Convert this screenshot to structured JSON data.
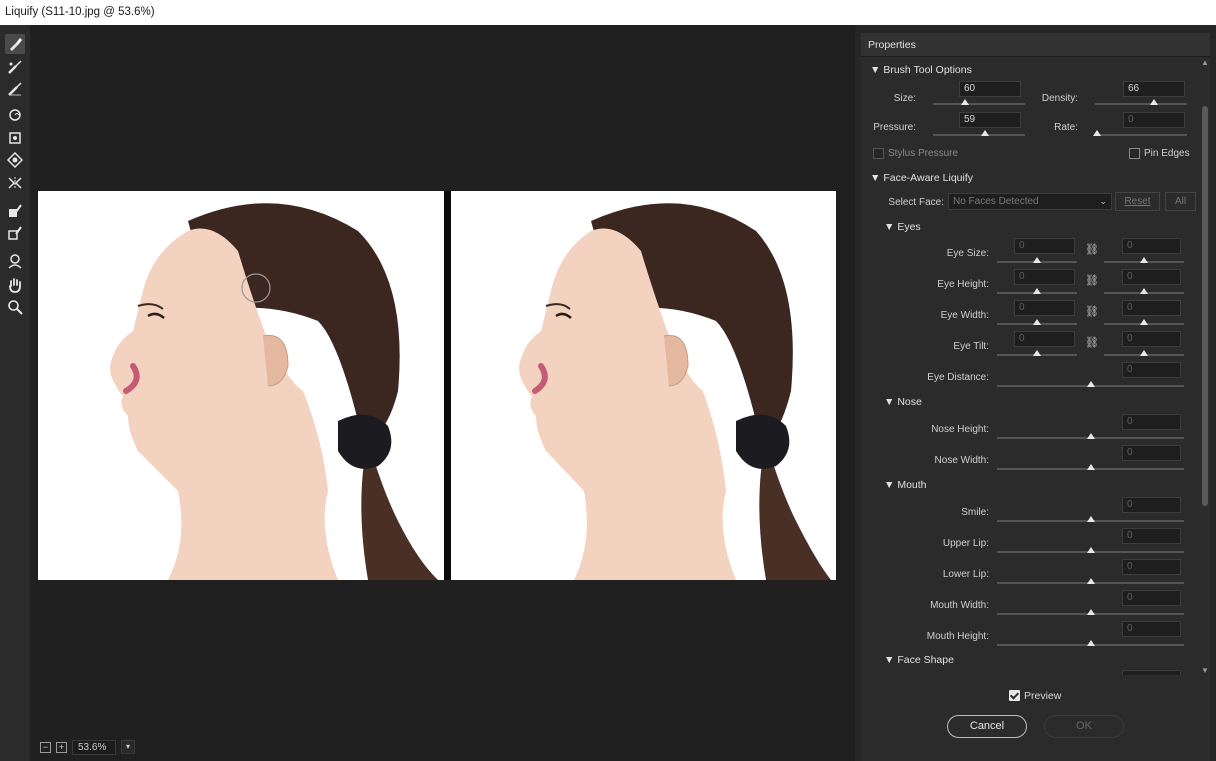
{
  "window": {
    "title": "Liquify (S11-10.jpg @ 53.6%)"
  },
  "toolbar": {
    "tools": [
      {
        "icon": "forward-warp-icon"
      },
      {
        "icon": "reconstruct-icon"
      },
      {
        "icon": "smooth-icon"
      },
      {
        "icon": "twirl-clockwise-icon"
      },
      {
        "icon": "pucker-icon"
      },
      {
        "icon": "bloat-icon"
      },
      {
        "icon": "push-left-icon"
      },
      {
        "icon": "freeze-mask-icon"
      },
      {
        "icon": "thaw-mask-icon"
      },
      {
        "icon": "face-tool-icon"
      },
      {
        "icon": "hand-icon"
      },
      {
        "icon": "zoom-icon"
      }
    ]
  },
  "canvas": {
    "zoom": "53.6%"
  },
  "panel": {
    "title": "Properties",
    "brush": {
      "title": "Brush Tool Options",
      "size_label": "Size:",
      "size": "60",
      "size_pct": 0.35,
      "density_label": "Density:",
      "density": "66",
      "density_pct": 0.64,
      "pressure_label": "Pressure:",
      "pressure": "59",
      "pressure_pct": 0.57,
      "rate_label": "Rate:",
      "rate": "0",
      "rate_pct": 0.02,
      "stylus_label": "Stylus Pressure",
      "pin_label": "Pin Edges"
    },
    "face": {
      "title": "Face-Aware Liquify",
      "select_label": "Select Face:",
      "select_value": "No Faces Detected",
      "reset_label": "Reset",
      "all_label": "All",
      "eyes": {
        "title": "Eyes",
        "rows": [
          {
            "label": "Eye Size:",
            "left": "0",
            "right": "0"
          },
          {
            "label": "Eye Height:",
            "left": "0",
            "right": "0"
          },
          {
            "label": "Eye Width:",
            "left": "0",
            "right": "0"
          },
          {
            "label": "Eye Tilt:",
            "left": "0",
            "right": "0"
          }
        ],
        "distance_label": "Eye Distance:",
        "distance": "0"
      },
      "nose": {
        "title": "Nose",
        "rows": [
          {
            "label": "Nose Height:",
            "value": "0"
          },
          {
            "label": "Nose Width:",
            "value": "0"
          }
        ]
      },
      "mouth": {
        "title": "Mouth",
        "rows": [
          {
            "label": "Smile:",
            "value": "0"
          },
          {
            "label": "Upper Lip:",
            "value": "0"
          },
          {
            "label": "Lower Lip:",
            "value": "0"
          },
          {
            "label": "Mouth Width:",
            "value": "0"
          },
          {
            "label": "Mouth Height:",
            "value": "0"
          }
        ]
      },
      "shape": {
        "title": "Face Shape"
      }
    }
  },
  "footer": {
    "preview_label": "Preview",
    "cancel_label": "Cancel",
    "ok_label": "OK"
  }
}
